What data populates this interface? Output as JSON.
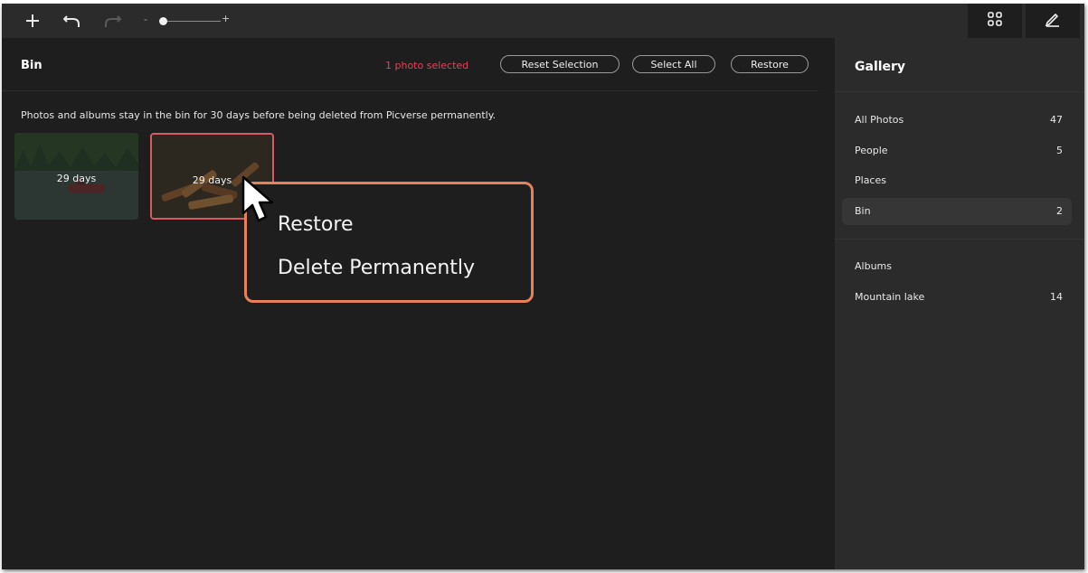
{
  "toolbar": {
    "add_icon": "plus-icon",
    "undo_icon": "undo-icon",
    "redo_icon": "redo-icon",
    "zoom_minus": "-",
    "zoom_plus": "+",
    "view_icon": "grid-icon",
    "edit_icon": "pencil-icon"
  },
  "main": {
    "title": "Bin",
    "selection_status": "1 photo selected",
    "reset_label": "Reset Selection",
    "select_all_label": "Select All",
    "restore_label": "Restore",
    "info_text": "Photos and albums stay in the bin for 30 days before being deleted from Picverse permanently.",
    "photos": [
      {
        "days": "29 days",
        "selected": false
      },
      {
        "days": "29 days",
        "selected": true
      }
    ]
  },
  "context_menu": {
    "items": [
      "Restore",
      "Delete Permanently"
    ]
  },
  "sidebar": {
    "title": "Gallery",
    "items": [
      {
        "label": "All Photos",
        "count": "47"
      },
      {
        "label": "People",
        "count": "5"
      },
      {
        "label": "Places",
        "count": ""
      },
      {
        "label": "Bin",
        "count": "2"
      }
    ],
    "albums_label": "Albums",
    "albums": [
      {
        "label": "Mountain lake",
        "count": "14"
      }
    ]
  },
  "colors": {
    "accent_selection": "#e0455a",
    "callout": "#e8815a",
    "background": "#1e1e1e",
    "sidebar": "#2b2b2b"
  }
}
